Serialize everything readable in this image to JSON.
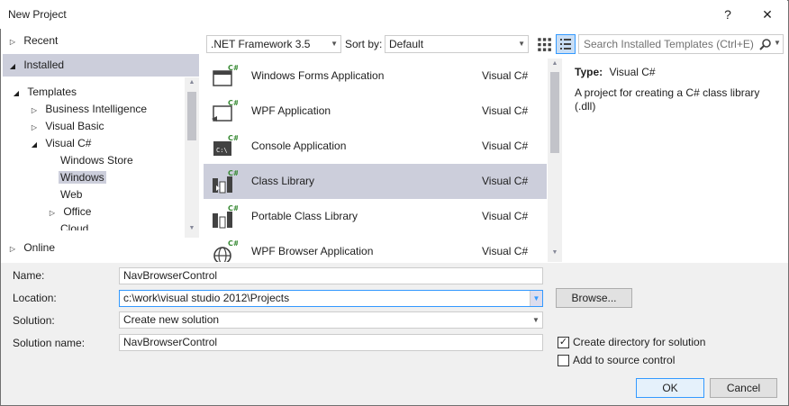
{
  "window": {
    "title": "New Project",
    "help_glyph": "?",
    "close_glyph": "✕"
  },
  "tree": {
    "recent": "Recent",
    "installed": "Installed",
    "templates": "Templates",
    "business_intelligence": "Business Intelligence",
    "visual_basic": "Visual Basic",
    "visual_csharp": "Visual C#",
    "windows_store": "Windows Store",
    "windows": "Windows",
    "web": "Web",
    "office": "Office",
    "cloud": "Cloud",
    "online": "Online"
  },
  "toolbar": {
    "framework": ".NET Framework 3.5",
    "sort_label": "Sort by:",
    "sort_value": "Default",
    "search_placeholder": "Search Installed Templates (Ctrl+E)"
  },
  "templates": [
    {
      "name": "Windows Forms Application",
      "lang": "Visual C#",
      "icon": "windows-forms-icon"
    },
    {
      "name": "WPF Application",
      "lang": "Visual C#",
      "icon": "wpf-icon"
    },
    {
      "name": "Console Application",
      "lang": "Visual C#",
      "icon": "console-icon"
    },
    {
      "name": "Class Library",
      "lang": "Visual C#",
      "icon": "class-library-icon",
      "selected": true
    },
    {
      "name": "Portable Class Library",
      "lang": "Visual C#",
      "icon": "portable-class-library-icon"
    },
    {
      "name": "WPF Browser Application",
      "lang": "Visual C#",
      "icon": "wpf-browser-icon"
    }
  ],
  "info": {
    "type_label": "Type:",
    "type_value": "Visual C#",
    "description": "A project for creating a C# class library (.dll)"
  },
  "form": {
    "name_label": "Name:",
    "name_value": "NavBrowserControl",
    "location_label": "Location:",
    "location_value": "c:\\work\\visual studio 2012\\Projects",
    "solution_label": "Solution:",
    "solution_value": "Create new solution",
    "solution_name_label": "Solution name:",
    "solution_name_value": "NavBrowserControl",
    "browse_label": "Browse...",
    "create_dir_label": "Create directory for solution",
    "create_dir_checked": true,
    "source_control_label": "Add to source control",
    "source_control_checked": false,
    "ok_label": "OK",
    "cancel_label": "Cancel"
  },
  "colors": {
    "selection": "#cccedb",
    "accent": "#3399ff",
    "csharp_badge": "#388a34"
  }
}
